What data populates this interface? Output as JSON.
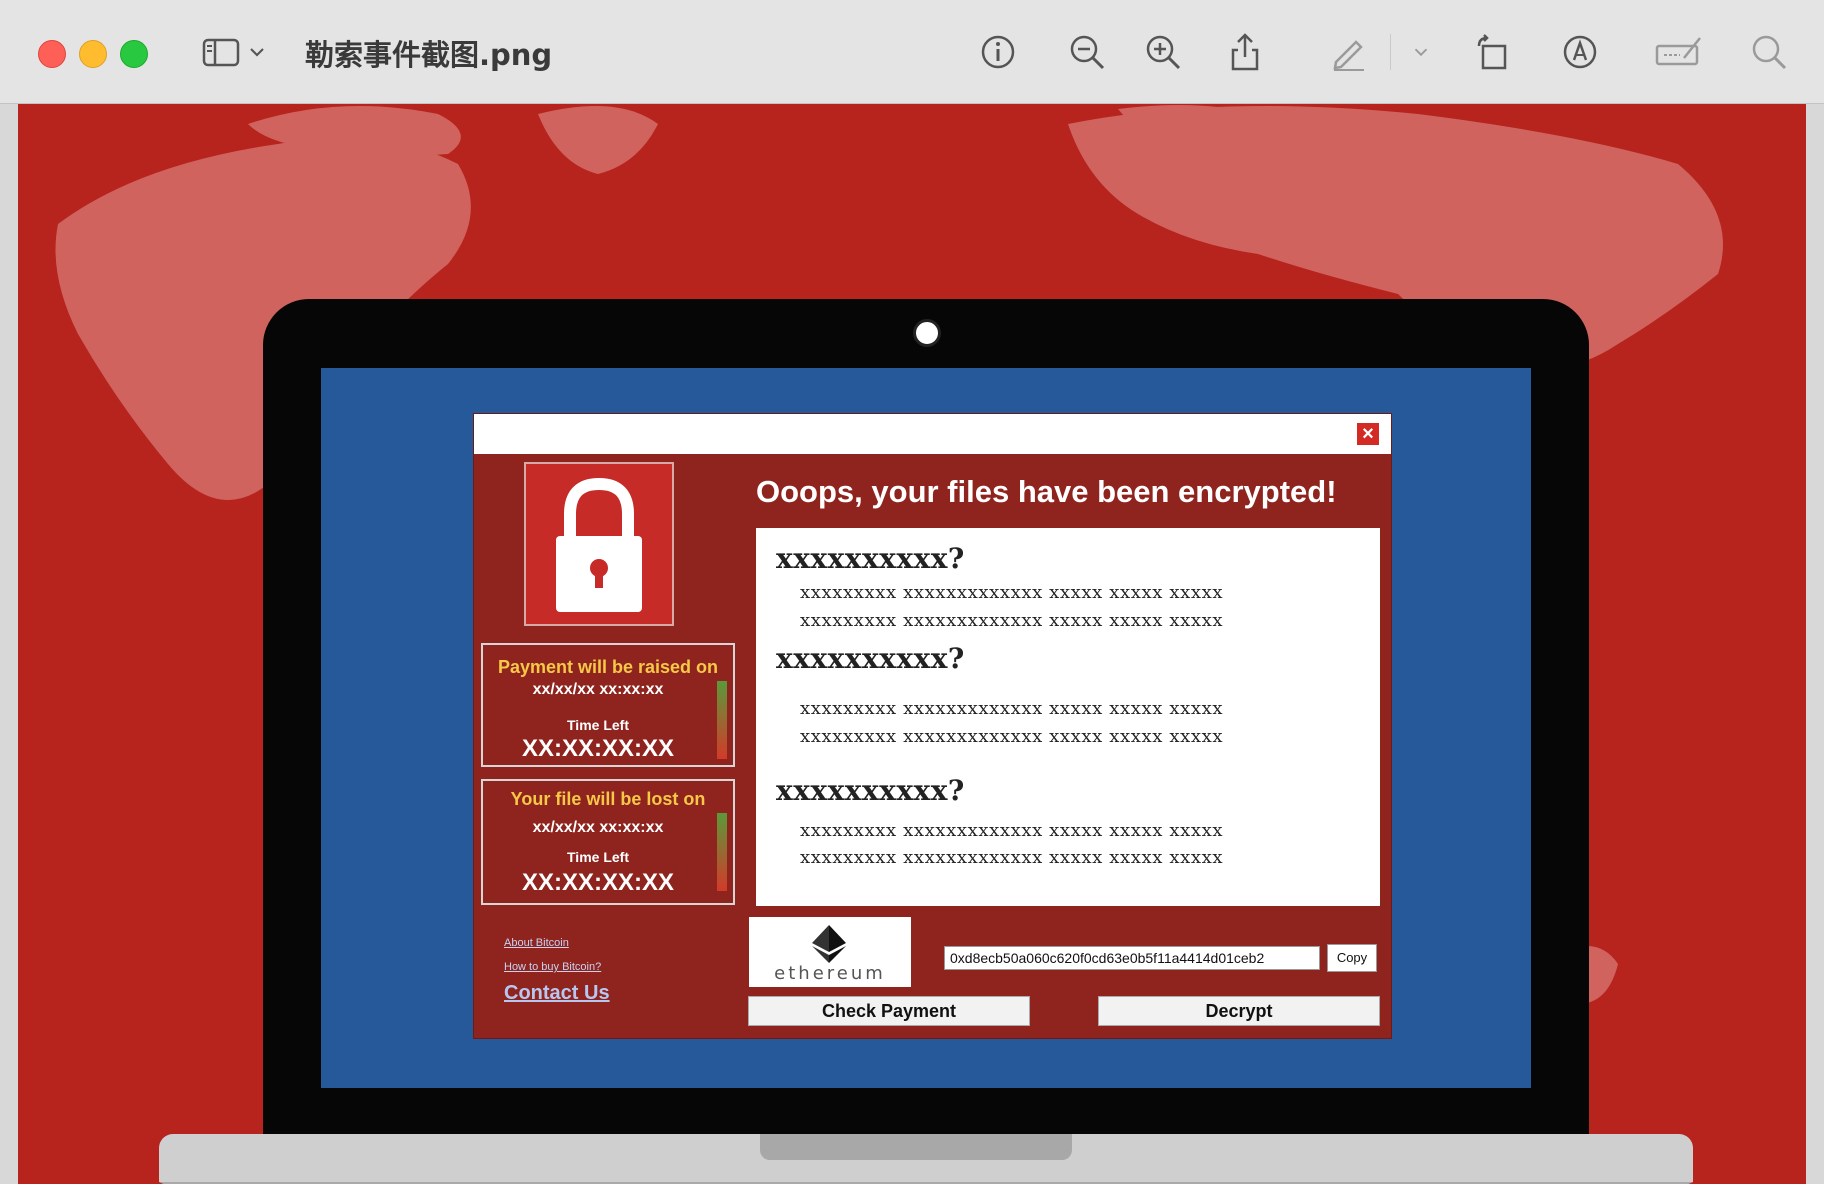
{
  "window": {
    "title": "勒索事件截图.png"
  },
  "dialog": {
    "headline": "Ooops, your files have been encrypted!",
    "sections": [
      {
        "question": "xxxxxxxxxx?",
        "lines": [
          "xxxxxxxxx xxxxxxxxxxxxx xxxxx xxxxx xxxxx",
          "xxxxxxxxx xxxxxxxxxxxxx xxxxx xxxxx xxxxx"
        ]
      },
      {
        "question": "xxxxxxxxxx?",
        "lines": [
          "xxxxxxxxx xxxxxxxxxxxxx xxxxx xxxxx xxxxx",
          "xxxxxxxxx xxxxxxxxxxxxx xxxxx xxxxx xxxxx"
        ]
      },
      {
        "question": "xxxxxxxxxx?",
        "lines": [
          "xxxxxxxxx xxxxxxxxxxxxx xxxxx xxxxx xxxxx",
          "xxxxxxxxx xxxxxxxxxxxxx xxxxx xxxxx xxxxx"
        ]
      }
    ],
    "timer_raise": {
      "label": "Payment will be raised on",
      "date": "xx/xx/xx xx:xx:xx",
      "time_left_label": "Time Left",
      "countdown": "XX:XX:XX:XX"
    },
    "timer_lost": {
      "label": "Your file will be lost on",
      "date": "xx/xx/xx xx:xx:xx",
      "time_left_label": "Time Left",
      "countdown": "XX:XX:XX:XX"
    },
    "links": {
      "about": "About Bitcoin",
      "how_to_buy": "How to buy Bitcoin?",
      "contact": "Contact Us"
    },
    "crypto_logo_text": "ethereum",
    "wallet_address": "0xd8ecb50a060c620f0cd63e0b5f11a4414d01ceb2",
    "copy_label": "Copy",
    "check_payment_label": "Check Payment",
    "decrypt_label": "Decrypt"
  },
  "colors": {
    "background_red": "#b7231d",
    "screen_blue": "#25599a",
    "dialog_red": "#8f241f",
    "accent_yellow": "#f6c847"
  },
  "icons": [
    "sidebar-icon",
    "chevron-down-icon",
    "info-icon",
    "zoom-out-icon",
    "zoom-in-icon",
    "share-icon",
    "pencil-icon",
    "rotate-icon",
    "markup-icon",
    "signature-icon",
    "search-icon",
    "lock-icon",
    "close-icon",
    "ethereum-icon"
  ]
}
